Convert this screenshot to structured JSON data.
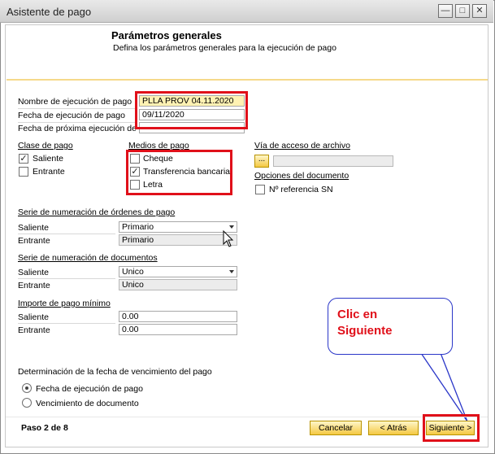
{
  "window": {
    "title": "Asistente de pago",
    "minimize_glyph": "—",
    "maximize_glyph": "□",
    "close_glyph": "✕"
  },
  "header": {
    "title": "Parámetros generales",
    "subtitle": "Defina los parámetros generales para la ejecución de pago"
  },
  "general": {
    "run_name_label": "Nombre de ejecución de pago",
    "run_name_value": "PLLA PROV 04.11.2020",
    "run_date_label": "Fecha de ejecución de pago",
    "run_date_value": "09/11/2020",
    "next_run_label": "Fecha de próxima ejecución de",
    "next_run_value": ""
  },
  "payment_class": {
    "title": "Clase de pago",
    "outgoing": "Saliente",
    "incoming": "Entrante",
    "outgoing_checked": true,
    "incoming_checked": false
  },
  "payment_methods": {
    "title": "Medios de pago",
    "check": "Cheque",
    "transfer": "Transferencia bancaria",
    "bill": "Letra",
    "check_checked": false,
    "transfer_checked": true,
    "bill_checked": false
  },
  "file_path": {
    "title": "Vía de acceso de archivo",
    "browse_label": "...",
    "value": ""
  },
  "doc_options": {
    "title": "Opciones del documento",
    "ref_label": "Nº referencia SN",
    "ref_checked": false
  },
  "payment_series": {
    "title": "Serie de numeración de órdenes de pago",
    "outgoing_label": "Saliente",
    "outgoing_value": "Primario",
    "incoming_label": "Entrante",
    "incoming_value": "Primario"
  },
  "doc_series": {
    "title": "Serie de numeración de documentos",
    "outgoing_label": "Saliente",
    "outgoing_value": "Unico",
    "incoming_label": "Entrante",
    "incoming_value": "Unico"
  },
  "min_amount": {
    "title": "Importe de pago mínimo",
    "outgoing_label": "Saliente",
    "outgoing_value": "0.00",
    "incoming_label": "Entrante",
    "incoming_value": "0.00"
  },
  "due_date": {
    "title": "Determinación de la fecha de vencimiento del pago",
    "option1": "Fecha de ejecución de pago",
    "option2": "Vencimiento de documento",
    "selected": "option1"
  },
  "footer": {
    "step": "Paso 2 de 8",
    "cancel": "Cancelar",
    "back": "< Atrás",
    "next": "Siguiente >"
  },
  "callout": {
    "line1": "Clic en",
    "line2": "Siguiente"
  },
  "colors": {
    "highlight": "#e0101a",
    "callout_border": "#2a36c8",
    "button": "#f4c842",
    "field_yellow": "#fff2b3"
  }
}
